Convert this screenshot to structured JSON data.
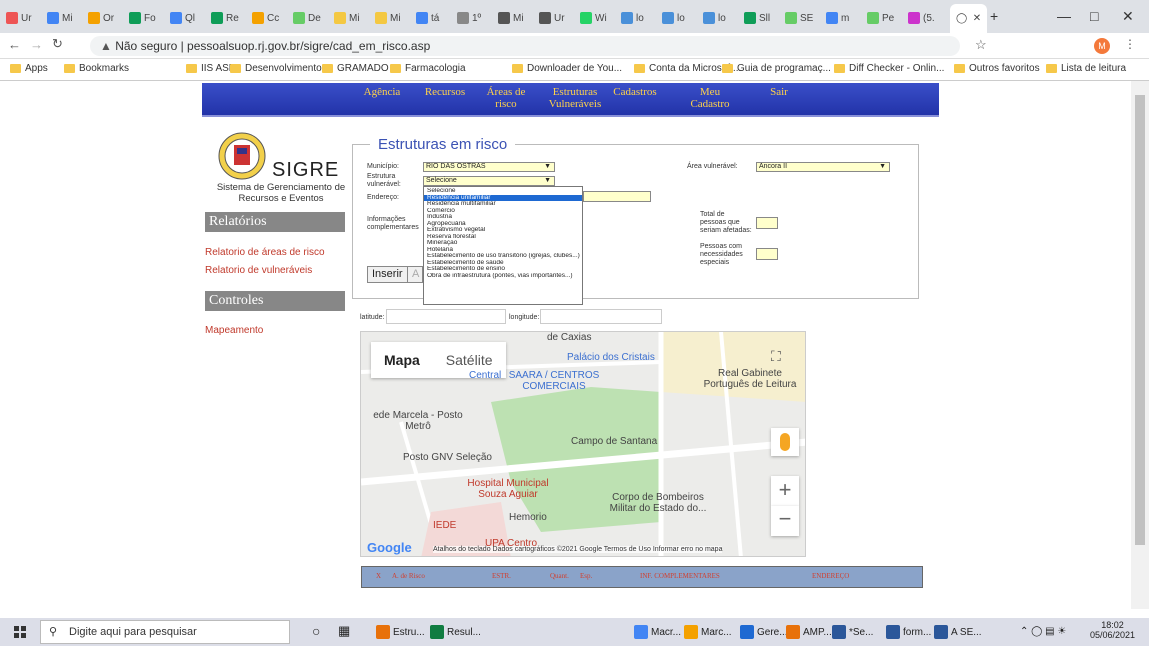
{
  "browser": {
    "tabs": [
      "Ur",
      "Mi",
      "Or",
      "Fo",
      "Ql",
      "Re",
      "Cc",
      "De",
      "Mi",
      "Mi",
      "tá",
      "1º",
      "Mi",
      "Ur",
      "Wi",
      "lo",
      "lo",
      "lo",
      "Sll",
      "SE",
      "m",
      "Pe",
      "(5."
    ],
    "url": "Não seguro | pessoalsuop.rj.gov.br/sigre/cad_em_risco.asp",
    "not_secure": "Não seguro",
    "bookmarks": [
      "Apps",
      "Bookmarks",
      "IIS ASP",
      "Desenvolvimento",
      "GRAMADO",
      "Farmacologia",
      "Downloader de You...",
      "Conta da Microsoft...",
      "Guia de programaç...",
      "Diff Checker - Onlin...",
      "Outros favoritos",
      "Lista de leitura"
    ]
  },
  "nav": [
    "Agência",
    "Recursos",
    "Áreas de risco",
    "Estruturas Vulneráveis",
    "Cadastros",
    "Meu Cadastro",
    "Sair"
  ],
  "logo": {
    "name": "SIGRE",
    "subtitle": "Sistema de Gerenciamento de Recursos e Eventos"
  },
  "sidebar": {
    "relatorios": "Relatórios",
    "rel_links": [
      "Relatorio de áreas de risco",
      "Relatorio de vulneráveis"
    ],
    "controles": "Controles",
    "ctrl_links": [
      "Mapeamento"
    ]
  },
  "form": {
    "legend": "Estruturas em risco",
    "municipio_label": "Município:",
    "municipio_value": "RIO DAS OSTRAS",
    "estrutura_label": "Estrutura vulnerável:",
    "estrutura_value": "Selecione",
    "endereco_label": "Endereço:",
    "info_label": "Informações complementares",
    "area_label": "Área vulnerável:",
    "area_value": "Ancora II",
    "total_label": "Total de pessoas que seriam afetadas:",
    "pessoas_label": "Pessoas com necessidades especiais",
    "inserir": "Inserir",
    "latitude": "latitude:",
    "longitude": "longitude:"
  },
  "dropdown": [
    "Selecione",
    "Residência unifamiliar",
    "Residência multifamiliar",
    "Comércio",
    "Indústria",
    "Agropecuária",
    "Extrativismo vegetal",
    "Reserva florestal",
    "Mineração",
    "Hotelaria",
    "Estabelecimento de uso transitório (igrejas, clubes...)",
    "Estabelecimento de saúde",
    "Estabelecimento de ensino",
    "Obra de infraestrutura (pontes, vias importantes...)"
  ],
  "dropdown_highlight": 1,
  "map": {
    "mapa": "Mapa",
    "satelite": "Satélite",
    "labels": [
      "de Caxias",
      "Palácio dos Cristais",
      "Central",
      "SAARA / CENTROS COMERCIAIS",
      "Real Gabinete Português de Leitura",
      "ede Marcela - Posto Metrô",
      "Campo de Santana",
      "Posto GNV Seleção",
      "Hospital Municipal Souza Aguiar",
      "Corpo de Bombeiros Militar do Estado do...",
      "Hemorio",
      "IEDE",
      "UPA Centro"
    ],
    "google": "Google",
    "footer": "Atalhos do teclado   Dados cartográficos ©2021 Google   Termos de Uso   Informar erro no mapa"
  },
  "table_headers": [
    "X",
    "A. de Risco",
    "ESTR.",
    "Quant.",
    "Esp.",
    "INF. COMPLEMENTARES",
    "ENDEREÇO"
  ],
  "taskbar": {
    "search": "Digite aqui para pesquisar",
    "apps": [
      "Estru...",
      "Resul...",
      "Macr...",
      "Marc...",
      "Gere...",
      "AMP...",
      "*Se...",
      "form...",
      "A SE..."
    ],
    "time": "18:02",
    "date": "05/06/2021"
  }
}
